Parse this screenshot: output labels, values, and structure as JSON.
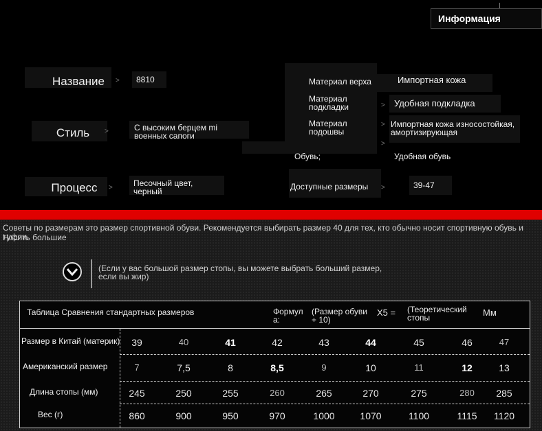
{
  "header": {
    "info_label": "Информация"
  },
  "product": {
    "name_label": "Название",
    "name_value": "8810",
    "style_label": "Стиль",
    "style_value": "С высоким берцем mi военных сапоги",
    "process_label": "Процесс",
    "process_value": "Песочный цвет, черный"
  },
  "materials": {
    "upper_label": "Материал верха",
    "upper_value": "Импортная кожа",
    "lining_label": "Материал подкладки",
    "lining_value": "Удобная подкладка",
    "sole_label": "Материал подошвы",
    "sole_value": "Импортная кожа износостойкая, амортизирующая",
    "shoes_label": "Обувь;",
    "shoes_value": "Удобная обувь",
    "sizes_label": "Доступные размеры",
    "sizes_value": "39-47"
  },
  "advice": {
    "text": "Советы по размерам это размер спортивной обуви. Рекомендуется выбирать размер 40 для тех, кто обычно носит спортивную обувь и туфли.",
    "overlap_text": "Носить большие"
  },
  "hint": {
    "text": "(Если у вас большой размер стопы, вы можете выбрать больший размер, если вы жир)"
  },
  "table": {
    "title": "Таблица Сравнения стандартных размеров",
    "formula_word": "Формул а:",
    "formula_part1": "(Размер обуви + 10)",
    "formula_part2": "X5 =",
    "formula_part3": "(Теоретический стопы",
    "unit": "Мм",
    "rows": [
      {
        "label": "Размер в Китай (материк)",
        "values": [
          "39",
          "40",
          "41",
          "42",
          "43",
          "44",
          "45",
          "46",
          "47"
        ]
      },
      {
        "label": "Американский размер",
        "values": [
          "7",
          "7,5",
          "8",
          "8,5",
          "9",
          "10",
          "11",
          "12",
          "13"
        ]
      },
      {
        "label": "Длина стопы (мм)",
        "values": [
          "245",
          "250",
          "255",
          "260",
          "265",
          "270",
          "275",
          "280",
          "285"
        ]
      },
      {
        "label": "Вес (г)",
        "values": [
          "860",
          "900",
          "950",
          "970",
          "1000",
          "1070",
          "1100",
          "1115",
          "1120"
        ]
      }
    ]
  }
}
